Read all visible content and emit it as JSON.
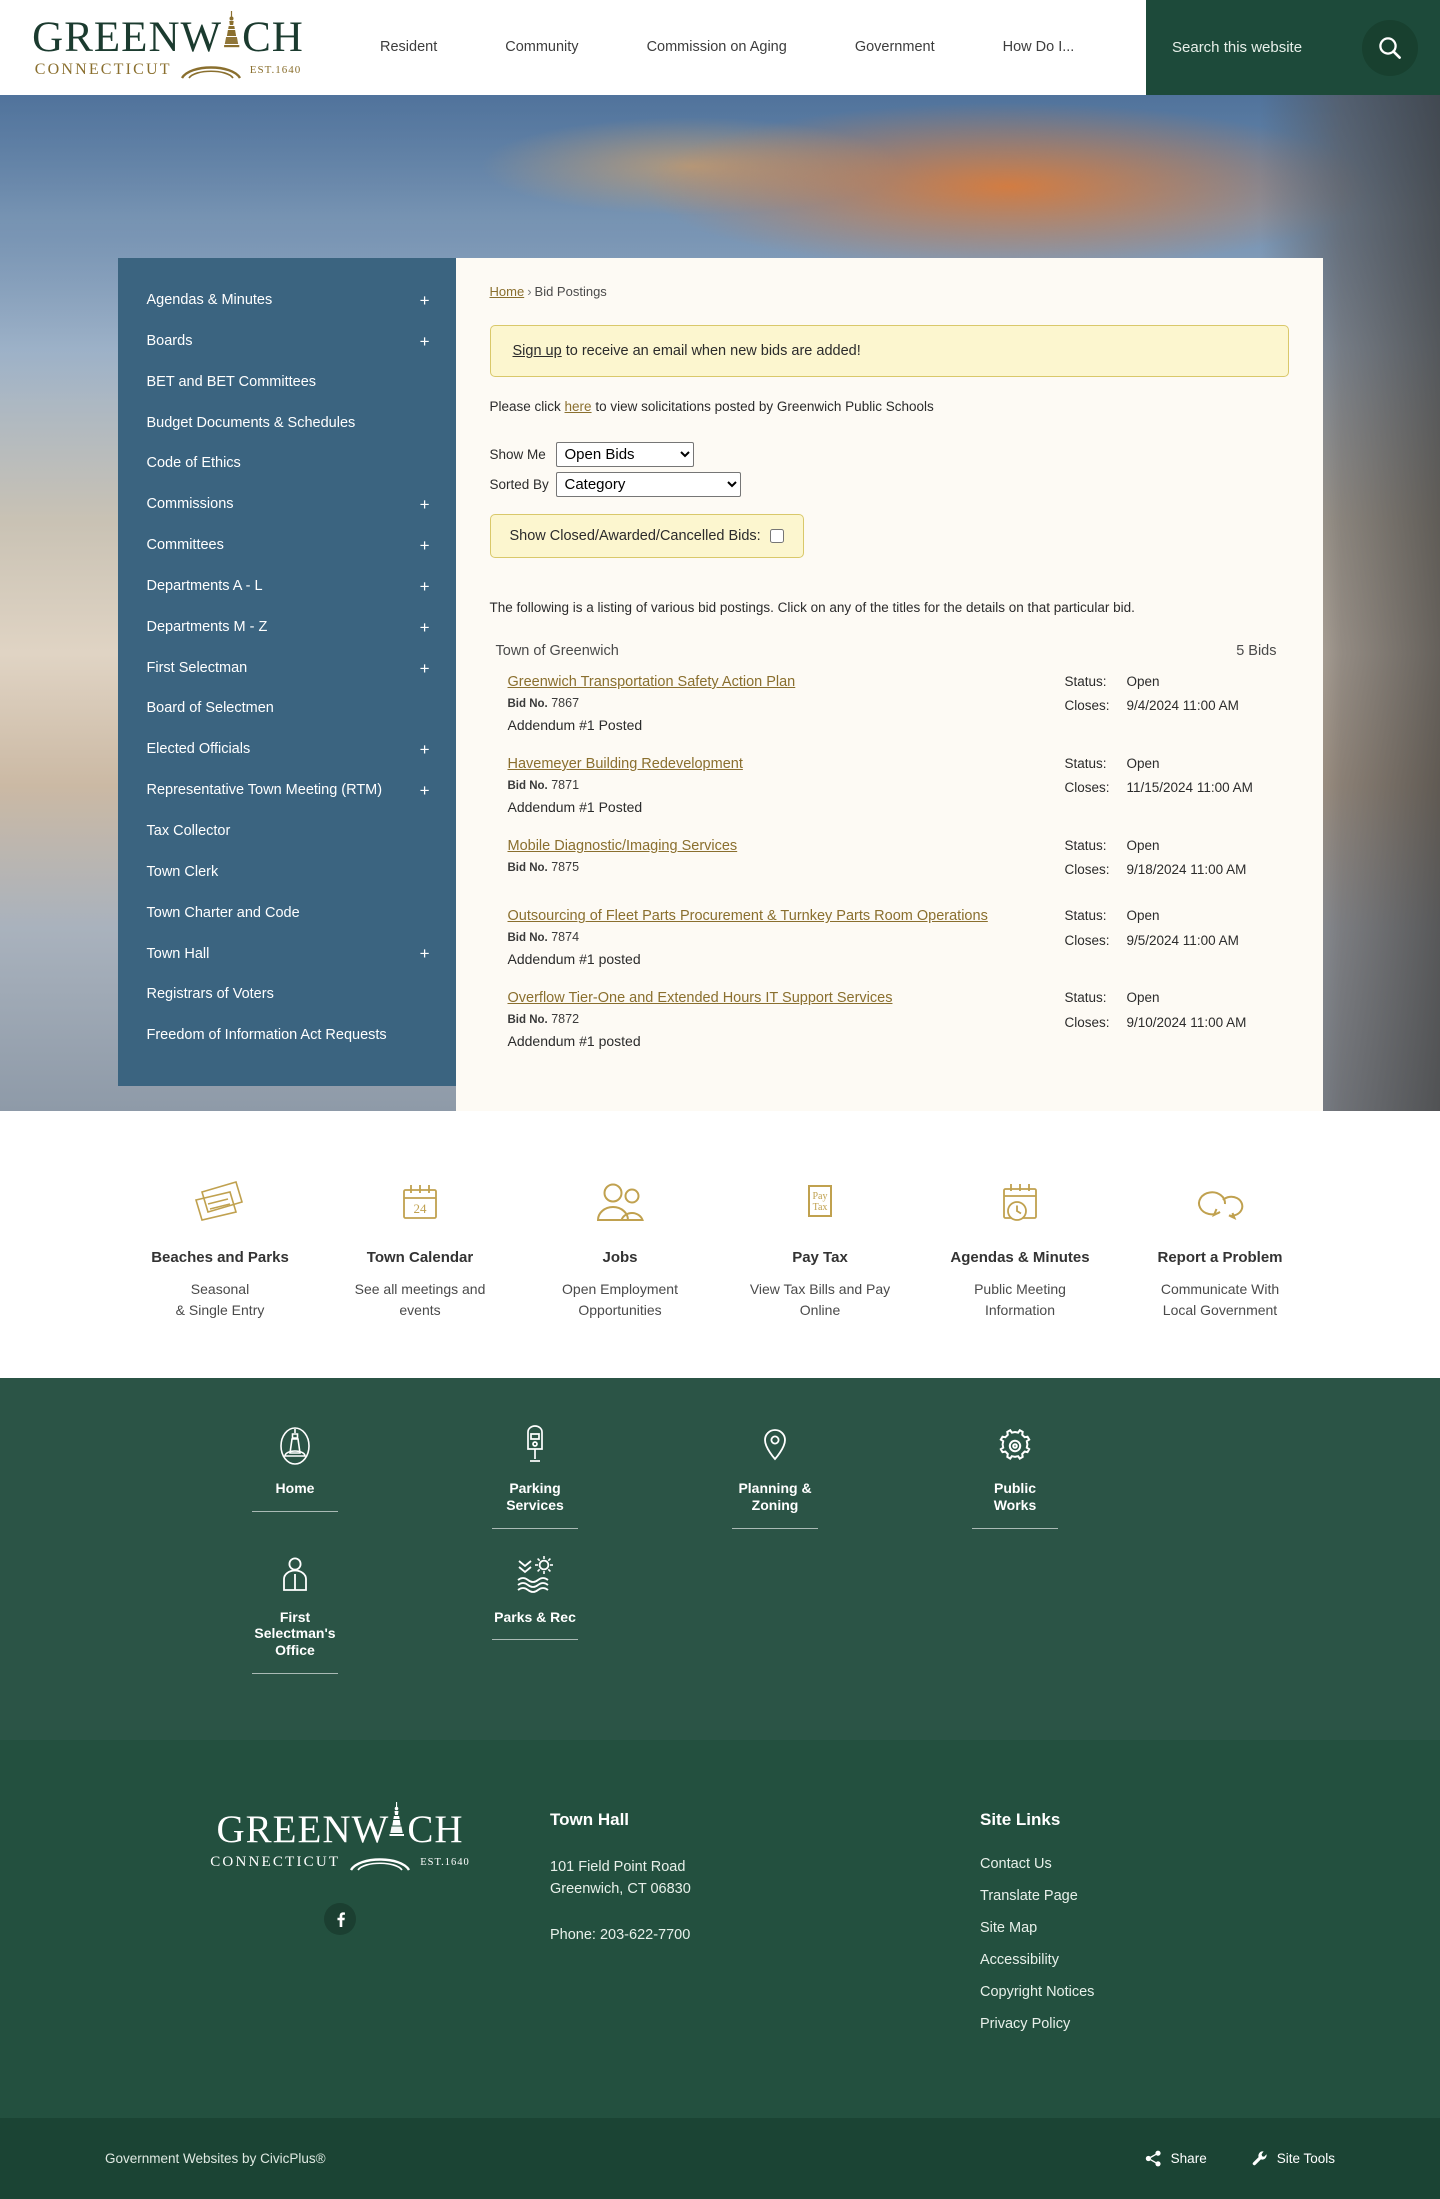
{
  "header": {
    "logo": {
      "main_pre": "GREENW",
      "main_post": "CH",
      "sub": "CONNECTICUT",
      "est": "EST.1640"
    },
    "nav": [
      {
        "label": "Resident"
      },
      {
        "label": "Community"
      },
      {
        "label": "Commission on Aging"
      },
      {
        "label": "Government"
      },
      {
        "label": "How Do I..."
      }
    ],
    "search": {
      "placeholder": "Search this website",
      "value": "",
      "icon": "search-icon"
    }
  },
  "sidebar": {
    "items": [
      {
        "label": "Agendas & Minutes",
        "expand": "+"
      },
      {
        "label": "Boards",
        "expand": "+"
      },
      {
        "label": "BET and BET Committees",
        "expand": ""
      },
      {
        "label": "Budget Documents & Schedules",
        "expand": ""
      },
      {
        "label": "Code of Ethics",
        "expand": ""
      },
      {
        "label": "Commissions",
        "expand": "+"
      },
      {
        "label": "Committees",
        "expand": "+"
      },
      {
        "label": "Departments A - L",
        "expand": "+"
      },
      {
        "label": "Departments M - Z",
        "expand": "+"
      },
      {
        "label": "First Selectman",
        "expand": "+"
      },
      {
        "label": "Board of Selectmen",
        "expand": ""
      },
      {
        "label": "Elected Officials",
        "expand": "+"
      },
      {
        "label": "Representative Town Meeting (RTM)",
        "expand": "+"
      },
      {
        "label": "Tax Collector",
        "expand": ""
      },
      {
        "label": "Town Clerk",
        "expand": ""
      },
      {
        "label": "Town Charter and Code",
        "expand": ""
      },
      {
        "label": "Town Hall",
        "expand": "+"
      },
      {
        "label": "Registrars of Voters",
        "expand": ""
      },
      {
        "label": "Freedom of Information Act Requests",
        "expand": ""
      }
    ]
  },
  "main": {
    "breadcrumb": {
      "home": "Home",
      "separator": "›",
      "current": "Bid Postings"
    },
    "notice": {
      "link": "Sign up",
      "rest": " to receive an email when new bids are added!"
    },
    "schools": {
      "pre": "Please click ",
      "link": "here",
      "post": " to view solicitations posted by Greenwich Public Schools"
    },
    "filters": {
      "show_me_label": "Show Me",
      "show_me_value": "Open Bids",
      "show_me_options": [
        "Open Bids"
      ],
      "sorted_by_label": "Sorted By",
      "sorted_by_value": "Category",
      "sorted_by_options": [
        "Category"
      ],
      "closed_label": "Show Closed/Awarded/Cancelled Bids:",
      "closed_checked": false
    },
    "listing_intro": "The following is a listing of various bid postings. Click on any of the titles for the details on that particular bid.",
    "group": {
      "name": "Town of Greenwich",
      "count": "5 Bids"
    },
    "labels": {
      "status": "Status:",
      "closes": "Closes:",
      "bid_no": "Bid No."
    },
    "bids": [
      {
        "title": "Greenwich Transportation Safety Action Plan",
        "bid_no": "7867",
        "addendum": "Addendum #1 Posted",
        "status": "Open",
        "closes": "9/4/2024 11:00 AM"
      },
      {
        "title": "Havemeyer Building Redevelopment",
        "bid_no": "7871",
        "addendum": "Addendum #1 Posted",
        "status": "Open",
        "closes": "11/15/2024 11:00 AM"
      },
      {
        "title": "Mobile Diagnostic/Imaging Services",
        "bid_no": "7875",
        "addendum": "",
        "status": "Open",
        "closes": "9/18/2024 11:00 AM"
      },
      {
        "title": "Outsourcing of Fleet Parts Procurement & Turnkey Parts Room Operations",
        "bid_no": "7874",
        "addendum": "Addendum #1 posted",
        "status": "Open",
        "closes": "9/5/2024 11:00 AM"
      },
      {
        "title": "Overflow Tier-One and Extended Hours IT Support Services",
        "bid_no": "7872",
        "addendum": "Addendum #1 posted",
        "status": "Open",
        "closes": "9/10/2024 11:00 AM"
      }
    ]
  },
  "quicklinks": [
    {
      "icon": "tickets-icon",
      "title": "Beaches and Parks",
      "desc_1": "Seasonal",
      "desc_2": "& Single Entry"
    },
    {
      "icon": "calendar-24-icon",
      "title": "Town Calendar",
      "desc_1": "See all meetings and",
      "desc_2": "events",
      "calendar_day": "24"
    },
    {
      "icon": "people-icon",
      "title": "Jobs",
      "desc_1": "Open Employment",
      "desc_2": "Opportunities"
    },
    {
      "icon": "pay-tax-icon",
      "title": "Pay Tax",
      "desc_1": "View Tax Bills and Pay",
      "desc_2": "Online",
      "icon_text_1": "Pay",
      "icon_text_2": "Tax"
    },
    {
      "icon": "calendar-clock-icon",
      "title": "Agendas & Minutes",
      "desc_1": "Public Meeting",
      "desc_2": "Information"
    },
    {
      "icon": "speech-bubbles-icon",
      "title": "Report a Problem",
      "desc_1": "Communicate With",
      "desc_2": "Local Government"
    }
  ],
  "greennav": [
    {
      "icon": "lighthouse-icon",
      "label": "Home"
    },
    {
      "icon": "parking-meter-icon",
      "label_1": "Parking",
      "label_2": "Services"
    },
    {
      "icon": "map-pin-icon",
      "label_1": "Planning &",
      "label_2": "Zoning"
    },
    {
      "icon": "gear-icon",
      "label_1": "Public",
      "label_2": "Works"
    },
    {
      "icon": "person-icon",
      "label_1": "First",
      "label_2": "Selectman's",
      "label_3": "Office"
    },
    {
      "icon": "parks-rec-icon",
      "label": "Parks & Rec"
    }
  ],
  "footer": {
    "logo": {
      "main_pre": "GREENW",
      "main_post": "CH",
      "sub": "CONNECTICUT",
      "est": "EST.1640"
    },
    "social": {
      "facebook": "facebook-icon"
    },
    "town_hall": {
      "heading": "Town Hall",
      "address_1": "101 Field Point Road",
      "address_2": "Greenwich, CT 06830",
      "phone": "Phone: 203-622-7700"
    },
    "site_links": {
      "heading": "Site Links",
      "items": [
        {
          "label": "Contact Us"
        },
        {
          "label": "Translate Page"
        },
        {
          "label": "Site Map"
        },
        {
          "label": "Accessibility"
        },
        {
          "label": "Copyright Notices"
        },
        {
          "label": "Privacy Policy"
        }
      ]
    }
  },
  "bottombar": {
    "credit": "Government Websites by CivicPlus®",
    "share": {
      "label": "Share",
      "icon": "share-icon"
    },
    "site_tools": {
      "label": "Site Tools",
      "icon": "wrench-icon"
    }
  },
  "colors": {
    "brand_green": "#1d4a3a",
    "footer_green": "#23503f",
    "greennav_green": "#2b5446",
    "bottombar_green": "#1b4434",
    "sidebar_blue": "#3b6480",
    "gold": "#8a6f2e",
    "notice_bg": "#fcf6cf",
    "notice_border": "#d9c86a",
    "card_bg": "#fdfaf4"
  }
}
